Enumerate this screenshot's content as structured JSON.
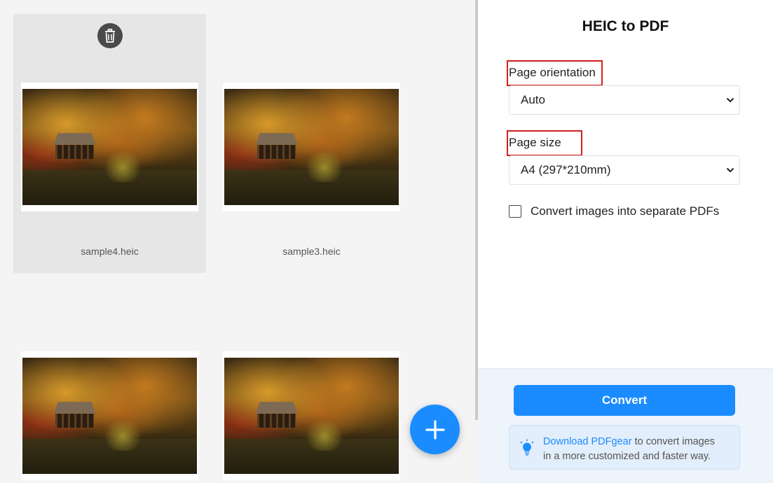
{
  "panel": {
    "title": "HEIC to PDF",
    "orientation_label": "Page orientation",
    "orientation_value": "Auto",
    "size_label": "Page size",
    "size_value": "A4 (297*210mm)",
    "separate_checkbox_label": "Convert images into separate PDFs",
    "separate_checked": false,
    "convert_label": "Convert",
    "promo": {
      "link_text": "Download PDFgear",
      "text_line1": " to convert images",
      "text_line2": "in a more customized and faster way."
    }
  },
  "files": [
    {
      "name": "sample4.heic",
      "selected": true
    },
    {
      "name": "sample3.heic",
      "selected": false
    },
    {
      "name": "",
      "selected": false
    },
    {
      "name": "",
      "selected": false
    }
  ],
  "icons": {
    "delete": "trash-icon",
    "add": "plus-icon",
    "dropdown": "chevron-down-icon",
    "tip": "lightbulb-icon"
  },
  "colors": {
    "accent": "#1a8cff",
    "highlight": "#d11f1f",
    "selected_card": "#e6e6e6"
  }
}
